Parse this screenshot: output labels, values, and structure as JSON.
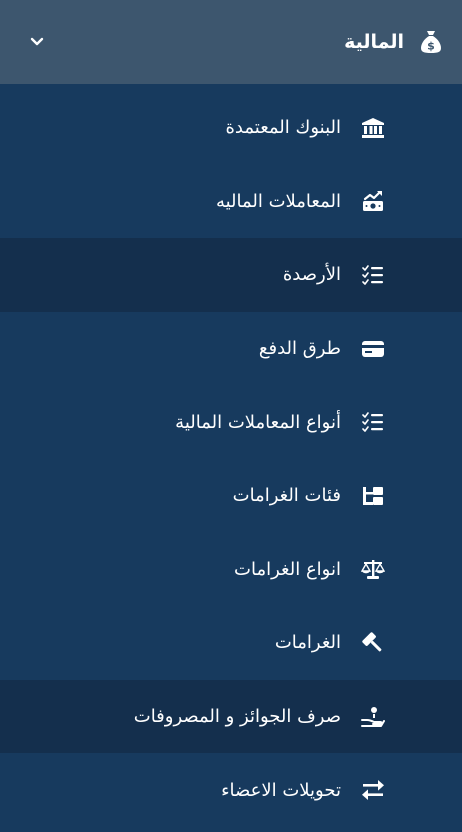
{
  "header": {
    "title": "المالية",
    "icon": "money-bag-icon",
    "chevron": "chevron-down-icon"
  },
  "menu": {
    "items": [
      {
        "label": "البنوك المعتمدة",
        "icon": "bank-icon"
      },
      {
        "label": "المعاملات الماليه",
        "icon": "money-transactions-icon"
      },
      {
        "label": "الأرصدة",
        "icon": "checklist-icon",
        "active": true
      },
      {
        "label": "طرق الدفع",
        "icon": "credit-card-icon"
      },
      {
        "label": "أنواع المعاملات المالية",
        "icon": "checklist-icon"
      },
      {
        "label": "فئات الغرامات",
        "icon": "category-tree-icon"
      },
      {
        "label": "انواع الغرامات",
        "icon": "scale-icon"
      },
      {
        "label": "الغرامات",
        "icon": "gavel-icon"
      },
      {
        "label": "صرف الجوائز و المصروفات",
        "icon": "hand-coin-icon",
        "active": true
      },
      {
        "label": "تحويلات الاعضاء",
        "icon": "exchange-icon"
      }
    ]
  },
  "colors": {
    "header_bg": "#3d566e",
    "sidebar_bg": "#173a5e",
    "active_bg": "#142f4d",
    "text": "#ffffff"
  }
}
